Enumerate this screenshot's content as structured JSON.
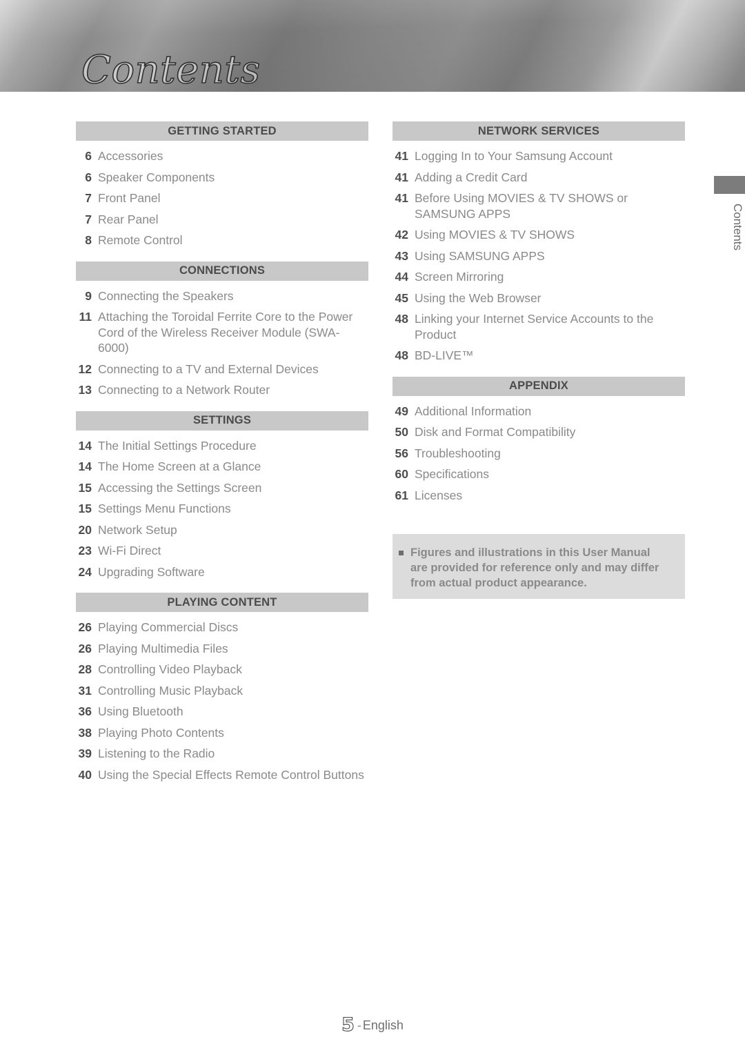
{
  "header": {
    "title": "Contents"
  },
  "side_tab": {
    "label": "Contents"
  },
  "columns": {
    "left": [
      {
        "heading": "GETTING STARTED",
        "entries": [
          {
            "page": "6",
            "title": "Accessories"
          },
          {
            "page": "6",
            "title": "Speaker Components"
          },
          {
            "page": "7",
            "title": "Front Panel"
          },
          {
            "page": "7",
            "title": "Rear Panel"
          },
          {
            "page": "8",
            "title": "Remote Control"
          }
        ]
      },
      {
        "heading": "CONNECTIONS",
        "entries": [
          {
            "page": "9",
            "title": "Connecting the Speakers"
          },
          {
            "page": "11",
            "title": "Attaching the Toroidal Ferrite Core to the Power Cord of the Wireless Receiver Module (SWA-6000)"
          },
          {
            "page": "12",
            "title": "Connecting to a TV and External Devices"
          },
          {
            "page": "13",
            "title": "Connecting to a Network Router"
          }
        ]
      },
      {
        "heading": "SETTINGS",
        "entries": [
          {
            "page": "14",
            "title": "The Initial Settings Procedure"
          },
          {
            "page": "14",
            "title": "The Home Screen at a Glance"
          },
          {
            "page": "15",
            "title": "Accessing the Settings Screen"
          },
          {
            "page": "15",
            "title": "Settings Menu Functions"
          },
          {
            "page": "20",
            "title": "Network Setup"
          },
          {
            "page": "23",
            "title": "Wi-Fi Direct"
          },
          {
            "page": "24",
            "title": "Upgrading Software"
          }
        ]
      },
      {
        "heading": "PLAYING CONTENT",
        "entries": [
          {
            "page": "26",
            "title": "Playing Commercial Discs"
          },
          {
            "page": "26",
            "title": "Playing Multimedia Files"
          },
          {
            "page": "28",
            "title": "Controlling Video Playback"
          },
          {
            "page": "31",
            "title": "Controlling Music Playback"
          },
          {
            "page": "36",
            "title": "Using Bluetooth"
          },
          {
            "page": "38",
            "title": "Playing Photo Contents"
          },
          {
            "page": "39",
            "title": "Listening to the Radio"
          },
          {
            "page": "40",
            "title": "Using the Special Effects Remote Control Buttons"
          }
        ]
      }
    ],
    "right": [
      {
        "heading": "NETWORK SERVICES",
        "entries": [
          {
            "page": "41",
            "title": "Logging In to Your Samsung Account"
          },
          {
            "page": "41",
            "title": "Adding a Credit Card"
          },
          {
            "page": "41",
            "title": "Before Using MOVIES & TV SHOWS or SAMSUNG APPS"
          },
          {
            "page": "42",
            "title": "Using MOVIES & TV SHOWS"
          },
          {
            "page": "43",
            "title": "Using SAMSUNG APPS"
          },
          {
            "page": "44",
            "title": "Screen Mirroring"
          },
          {
            "page": "45",
            "title": "Using the Web Browser"
          },
          {
            "page": "48",
            "title": "Linking your Internet Service Accounts to the Product"
          },
          {
            "page": "48",
            "title": "BD-LIVE™"
          }
        ]
      },
      {
        "heading": "APPENDIX",
        "entries": [
          {
            "page": "49",
            "title": "Additional Information"
          },
          {
            "page": "50",
            "title": "Disk and Format Compatibility"
          },
          {
            "page": "56",
            "title": "Troubleshooting"
          },
          {
            "page": "60",
            "title": "Specifications"
          },
          {
            "page": "61",
            "title": "Licenses"
          }
        ]
      }
    ]
  },
  "note": {
    "text": "Figures and illustrations in this User Manual are provided for reference only and may differ from actual product appearance."
  },
  "footer": {
    "page_number": "5",
    "separator": "-",
    "language": "English"
  },
  "colors": {
    "section_band": "#c8c8c8",
    "note_background": "#dcdcdc",
    "page_number_text": "#4d4d4d",
    "entry_title_text": "#8a8a8a",
    "side_tab_block": "#7c7c7c"
  }
}
